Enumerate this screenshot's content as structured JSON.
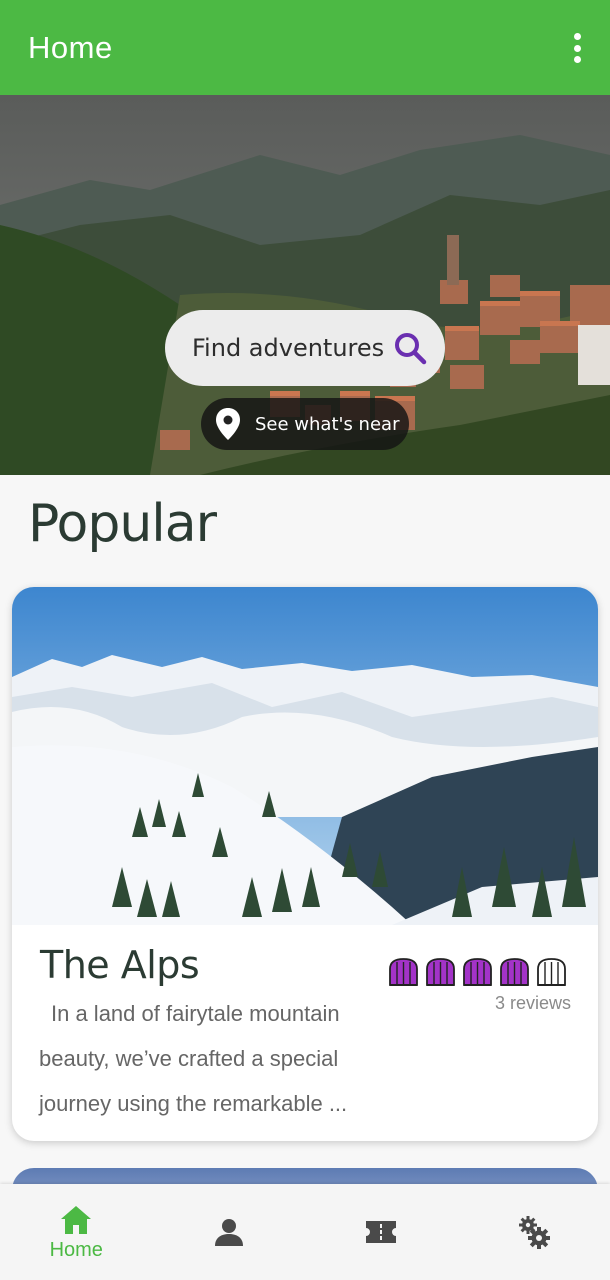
{
  "appbar": {
    "title": "Home"
  },
  "hero": {
    "search_text": "Find adventures",
    "near_label": "See what's near"
  },
  "popular": {
    "title": "Popular",
    "card": {
      "title": "The Alps",
      "rating": 4,
      "rating_max": 5,
      "reviews": "3 reviews",
      "description": "In a land of fairytale mountain beauty, we’ve crafted a special journey using the remarkable ..."
    }
  },
  "bottom_nav": {
    "items": [
      {
        "icon": "home-icon",
        "label": "Home",
        "active": true
      },
      {
        "icon": "person-icon",
        "label": "",
        "active": false
      },
      {
        "icon": "ticket-icon",
        "label": "",
        "active": false
      },
      {
        "icon": "settings-icon",
        "label": "",
        "active": false
      }
    ]
  },
  "colors": {
    "primary": "#4cb944",
    "rating": "#a333c8",
    "search_icon": "#6a2fb0",
    "inactive_icon": "#4a4a4a"
  }
}
